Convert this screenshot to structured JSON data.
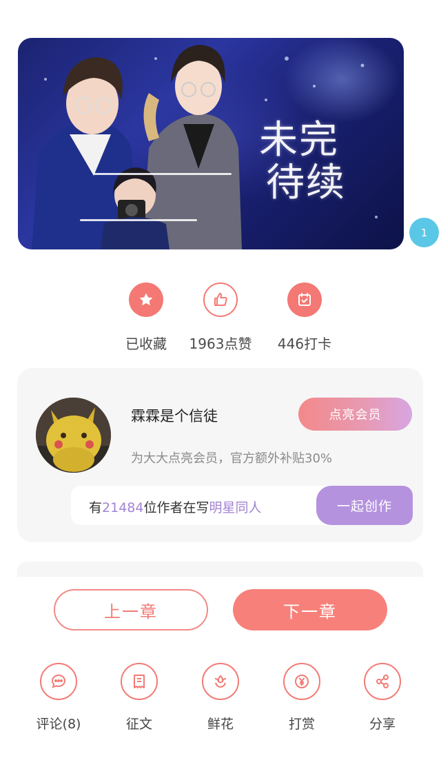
{
  "banner": {
    "title_line1": "未完",
    "title_line2": "待续",
    "image_description_icon": "cover-art"
  },
  "page_badge": "1",
  "stats": [
    {
      "icon": "star-icon",
      "label": "已收藏"
    },
    {
      "icon": "thumbs-up-icon",
      "label": "1963点赞"
    },
    {
      "icon": "calendar-check-icon",
      "label": "446打卡"
    }
  ],
  "author": {
    "name": "霖霖是个信徒",
    "member_button": "点亮会员",
    "member_note": "为大大点亮会员，官方额外补贴30%",
    "writers_prefix": "有",
    "writers_count": "21484",
    "writers_middle": "位作者在写",
    "writers_topic": "明星同人",
    "write_button": "一起创作"
  },
  "chapter_nav": {
    "prev": "上一章",
    "next": "下一章"
  },
  "actions": [
    {
      "icon": "comment-icon",
      "label": "评论(8)"
    },
    {
      "icon": "essay-icon",
      "label": "征文"
    },
    {
      "icon": "flower-icon",
      "label": "鲜花"
    },
    {
      "icon": "yen-coin-icon",
      "label": "打赏"
    },
    {
      "icon": "share-icon",
      "label": "分享"
    }
  ],
  "colors": {
    "accent": "#f47873",
    "purple": "#b592de",
    "badge": "#5bc7e6"
  }
}
